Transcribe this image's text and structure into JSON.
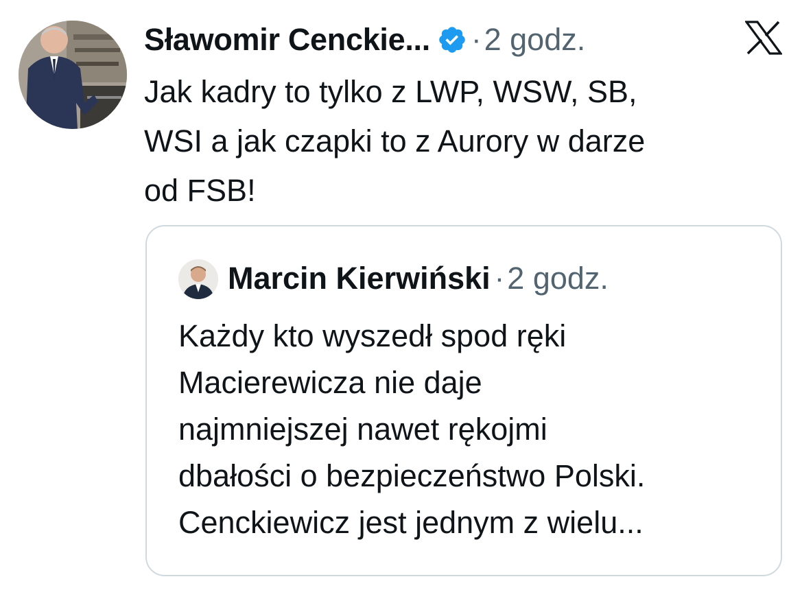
{
  "tweet": {
    "author_name": "Sławomir Cenckie...",
    "separator": "·",
    "time": "2 godz.",
    "text": "Jak kadry to tylko z LWP, WSW, SB,\nWSI a jak czapki to z Aurory w darze\nod FSB!",
    "avatar_icon": "author-avatar",
    "verified_icon": "verified-badge-icon",
    "platform_icon": "x-logo-icon"
  },
  "quoted_tweet": {
    "author_name": "Marcin Kierwiński",
    "separator": "·",
    "time": "2 godz.",
    "text": "Każdy kto wyszedł spod ręki\nMacierewicza nie daje\nnajmniejszej nawet rękojmi\ndbałości o bezpieczeństwo Polski.\nCenckiewicz jest jednym z wielu..."
  },
  "colors": {
    "verified": "#1d9bf0",
    "secondary_text": "#536471",
    "border": "#cfd9de",
    "primary_text": "#0f1419"
  }
}
